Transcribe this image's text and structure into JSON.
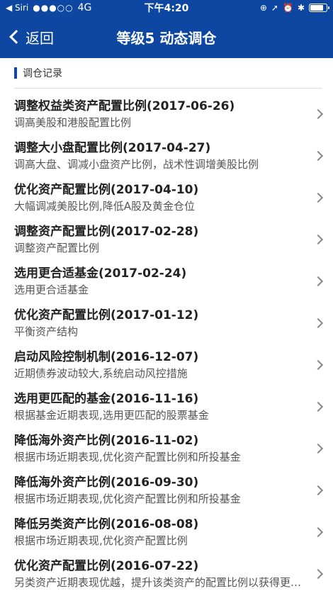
{
  "status": {
    "back_app": "Siri",
    "signal": "●●●○○",
    "network": "4G",
    "time": "下午4:20",
    "icons": [
      "rotation-lock-icon",
      "location-icon",
      "alarm-icon",
      "bluetooth-icon"
    ],
    "battery_level": 0.85
  },
  "nav": {
    "back_label": "返回",
    "title": "等级5 动态调仓"
  },
  "section": {
    "title": "调仓记录",
    "accent_color": "#0d47a1"
  },
  "items": [
    {
      "title": "调整权益类资产配置比例(2017-06-26)",
      "subtitle": "调高美股和港股配置比例"
    },
    {
      "title": "调整大小盘配置比例(2017-04-27)",
      "subtitle": "调高大盘、调减小盘资产比例，战术性调增美股比例"
    },
    {
      "title": "优化资产配置比例(2017-04-10)",
      "subtitle": "大幅调减美股比例,降低A股及黄金仓位"
    },
    {
      "title": "调整资产配置比例(2017-02-28)",
      "subtitle": "调整资产配置比例"
    },
    {
      "title": "选用更合适基金(2017-02-24)",
      "subtitle": "选用更合适基金"
    },
    {
      "title": "优化资产配置比例(2017-01-12)",
      "subtitle": "平衡资产结构"
    },
    {
      "title": "启动风险控制机制(2016-12-07)",
      "subtitle": "近期债券波动较大,系统启动风控措施"
    },
    {
      "title": "选用更匹配的基金(2016-11-16)",
      "subtitle": "根据基金近期表现,选用更匹配的股票基金"
    },
    {
      "title": "降低海外资产比例(2016-11-02)",
      "subtitle": "根据市场近期表现,优化资产配置比例和所投基金"
    },
    {
      "title": "降低海外资产比例(2016-09-30)",
      "subtitle": "根据市场近期表现,优化资产配置比例和所投基金"
    },
    {
      "title": "降低另类资产比例(2016-08-08)",
      "subtitle": "根据市场近期表现,优化资产配置比例"
    },
    {
      "title": "优化资产配置比例(2016-07-22)",
      "subtitle": "另类资产近期表现优越，提升该类资产的配置比例以获得更高收益"
    }
  ]
}
